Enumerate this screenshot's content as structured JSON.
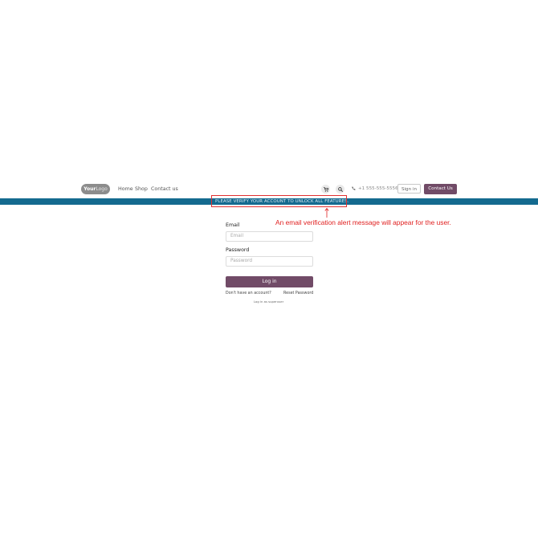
{
  "navbar": {
    "logo_bold": "Your",
    "logo_light": "Logo",
    "links": [
      "Home",
      "Shop",
      "Contact us"
    ],
    "cart_icon": "cart-icon",
    "search_icon": "search-icon",
    "phone": "+1 555-555-5556",
    "sign_in": "Sign in",
    "contact_us": "Contact Us"
  },
  "alert": {
    "text": "PLEASE VERIFY YOUR ACCOUNT TO UNLOCK ALL FEATURES.",
    "bar_color": "#146a8f",
    "annotation": "An email verification alert message will appear for the user.",
    "annotation_color": "#e02020"
  },
  "form": {
    "email_label": "Email",
    "email_placeholder": "Email",
    "password_label": "Password",
    "password_placeholder": "Password",
    "login_button": "Log in",
    "signup_link": "Don't have an account?",
    "reset_link": "Reset Password",
    "superuser_link": "Log in as superuser"
  },
  "colors": {
    "primary": "#714b67"
  }
}
